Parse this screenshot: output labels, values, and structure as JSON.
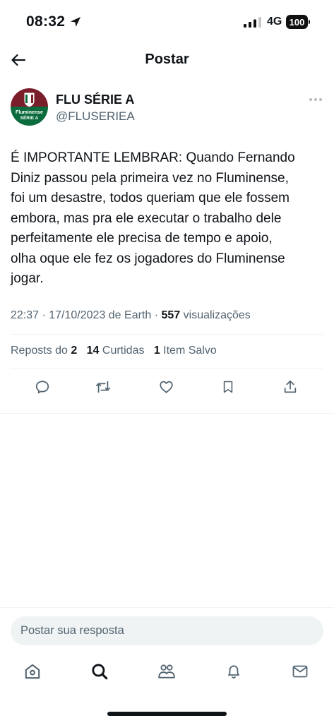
{
  "status_bar": {
    "time": "08:32",
    "network": "4G",
    "battery": "100"
  },
  "header": {
    "title": "Postar"
  },
  "post": {
    "author_name": "FLU SÉRIE A",
    "author_handle": "@FLUSERIEA",
    "avatar_text": [
      "Fluminense",
      "SÉRIE A"
    ],
    "text_lines": [
      "É IMPORTANTE LEMBRAR: Quando Fernando",
      "Diniz passou pela primeira vez no Fluminense,",
      "foi um desastre,  todos queriam que ele fossem",
      "embora, mas pra ele executar o trabalho dele",
      "perfeitamente ele precisa de tempo e apoio,",
      "olha oque ele fez os jogadores do Fluminense",
      "jogar."
    ],
    "timestamp": "22:37 · 17/10/2023 de Earth · ",
    "views_count": "557",
    "views_label": " visualizações"
  },
  "stats": {
    "reposts_label": "Reposts do ",
    "reposts_count": "2",
    "likes_count": "14",
    "likes_label": " Curtidas",
    "saves_count": "1",
    "saves_label": " Item Salvo"
  },
  "reply": {
    "placeholder": "Postar sua resposta"
  },
  "icons": {
    "back": "arrow-left-icon",
    "more": "more-horizontal-icon",
    "reply": "comment-icon",
    "repost": "repost-icon",
    "like": "heart-icon",
    "bookmark": "bookmark-icon",
    "share": "share-icon",
    "nav": [
      "home-icon",
      "search-icon",
      "communities-icon",
      "notifications-icon",
      "messages-icon"
    ]
  },
  "colors": {
    "text": "#0f1419",
    "secondary_text": "#536471",
    "divider": "#eff3f4",
    "avatar_green": "#0a6b3d",
    "avatar_maroon": "#7b1e2c"
  }
}
